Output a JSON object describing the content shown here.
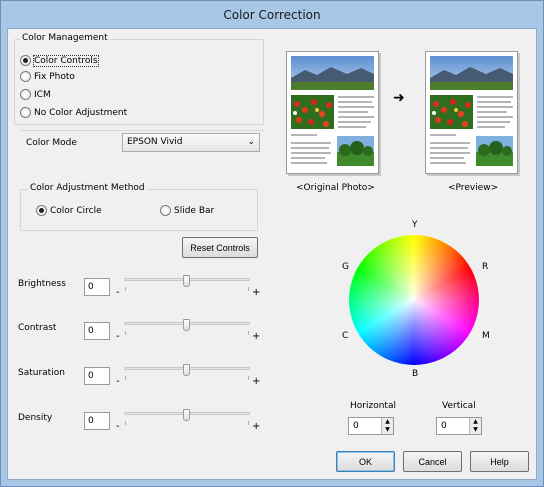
{
  "window": {
    "title": "Color Correction"
  },
  "color_management": {
    "legend": "Color Management",
    "options": [
      {
        "label": "Color Controls",
        "selected": true
      },
      {
        "label": "Fix Photo",
        "selected": false
      },
      {
        "label": "ICM",
        "selected": false
      },
      {
        "label": "No Color Adjustment",
        "selected": false
      }
    ]
  },
  "color_mode": {
    "label": "Color Mode",
    "value": "EPSON Vivid"
  },
  "adjustment_method": {
    "legend": "Color Adjustment Method",
    "options": [
      {
        "label": "Color Circle",
        "selected": true
      },
      {
        "label": "Slide Bar",
        "selected": false
      }
    ]
  },
  "reset_button": "Reset Controls",
  "sliders": [
    {
      "label": "Brightness",
      "value": "0",
      "minus": "-",
      "plus": "+"
    },
    {
      "label": "Contrast",
      "value": "0",
      "minus": "-",
      "plus": "+"
    },
    {
      "label": "Saturation",
      "value": "0",
      "minus": "-",
      "plus": "+"
    },
    {
      "label": "Density",
      "value": "0",
      "minus": "-",
      "plus": "+"
    }
  ],
  "preview": {
    "original_label": "<Original Photo>",
    "preview_label": "<Preview>"
  },
  "color_circle": {
    "labels": {
      "top": "Y",
      "upper_left": "G",
      "upper_right": "R",
      "lower_left": "C",
      "lower_right": "M",
      "bottom": "B"
    }
  },
  "offsets": {
    "horizontal_label": "Horizontal",
    "horizontal_value": "0",
    "vertical_label": "Vertical",
    "vertical_value": "0"
  },
  "footer": {
    "ok": "OK",
    "cancel": "Cancel",
    "help": "Help"
  },
  "colors": {
    "title_bar": "#a8c6e6",
    "dialog_bg": "#f0f0f0",
    "default_button_border": "#3c7fb1"
  }
}
